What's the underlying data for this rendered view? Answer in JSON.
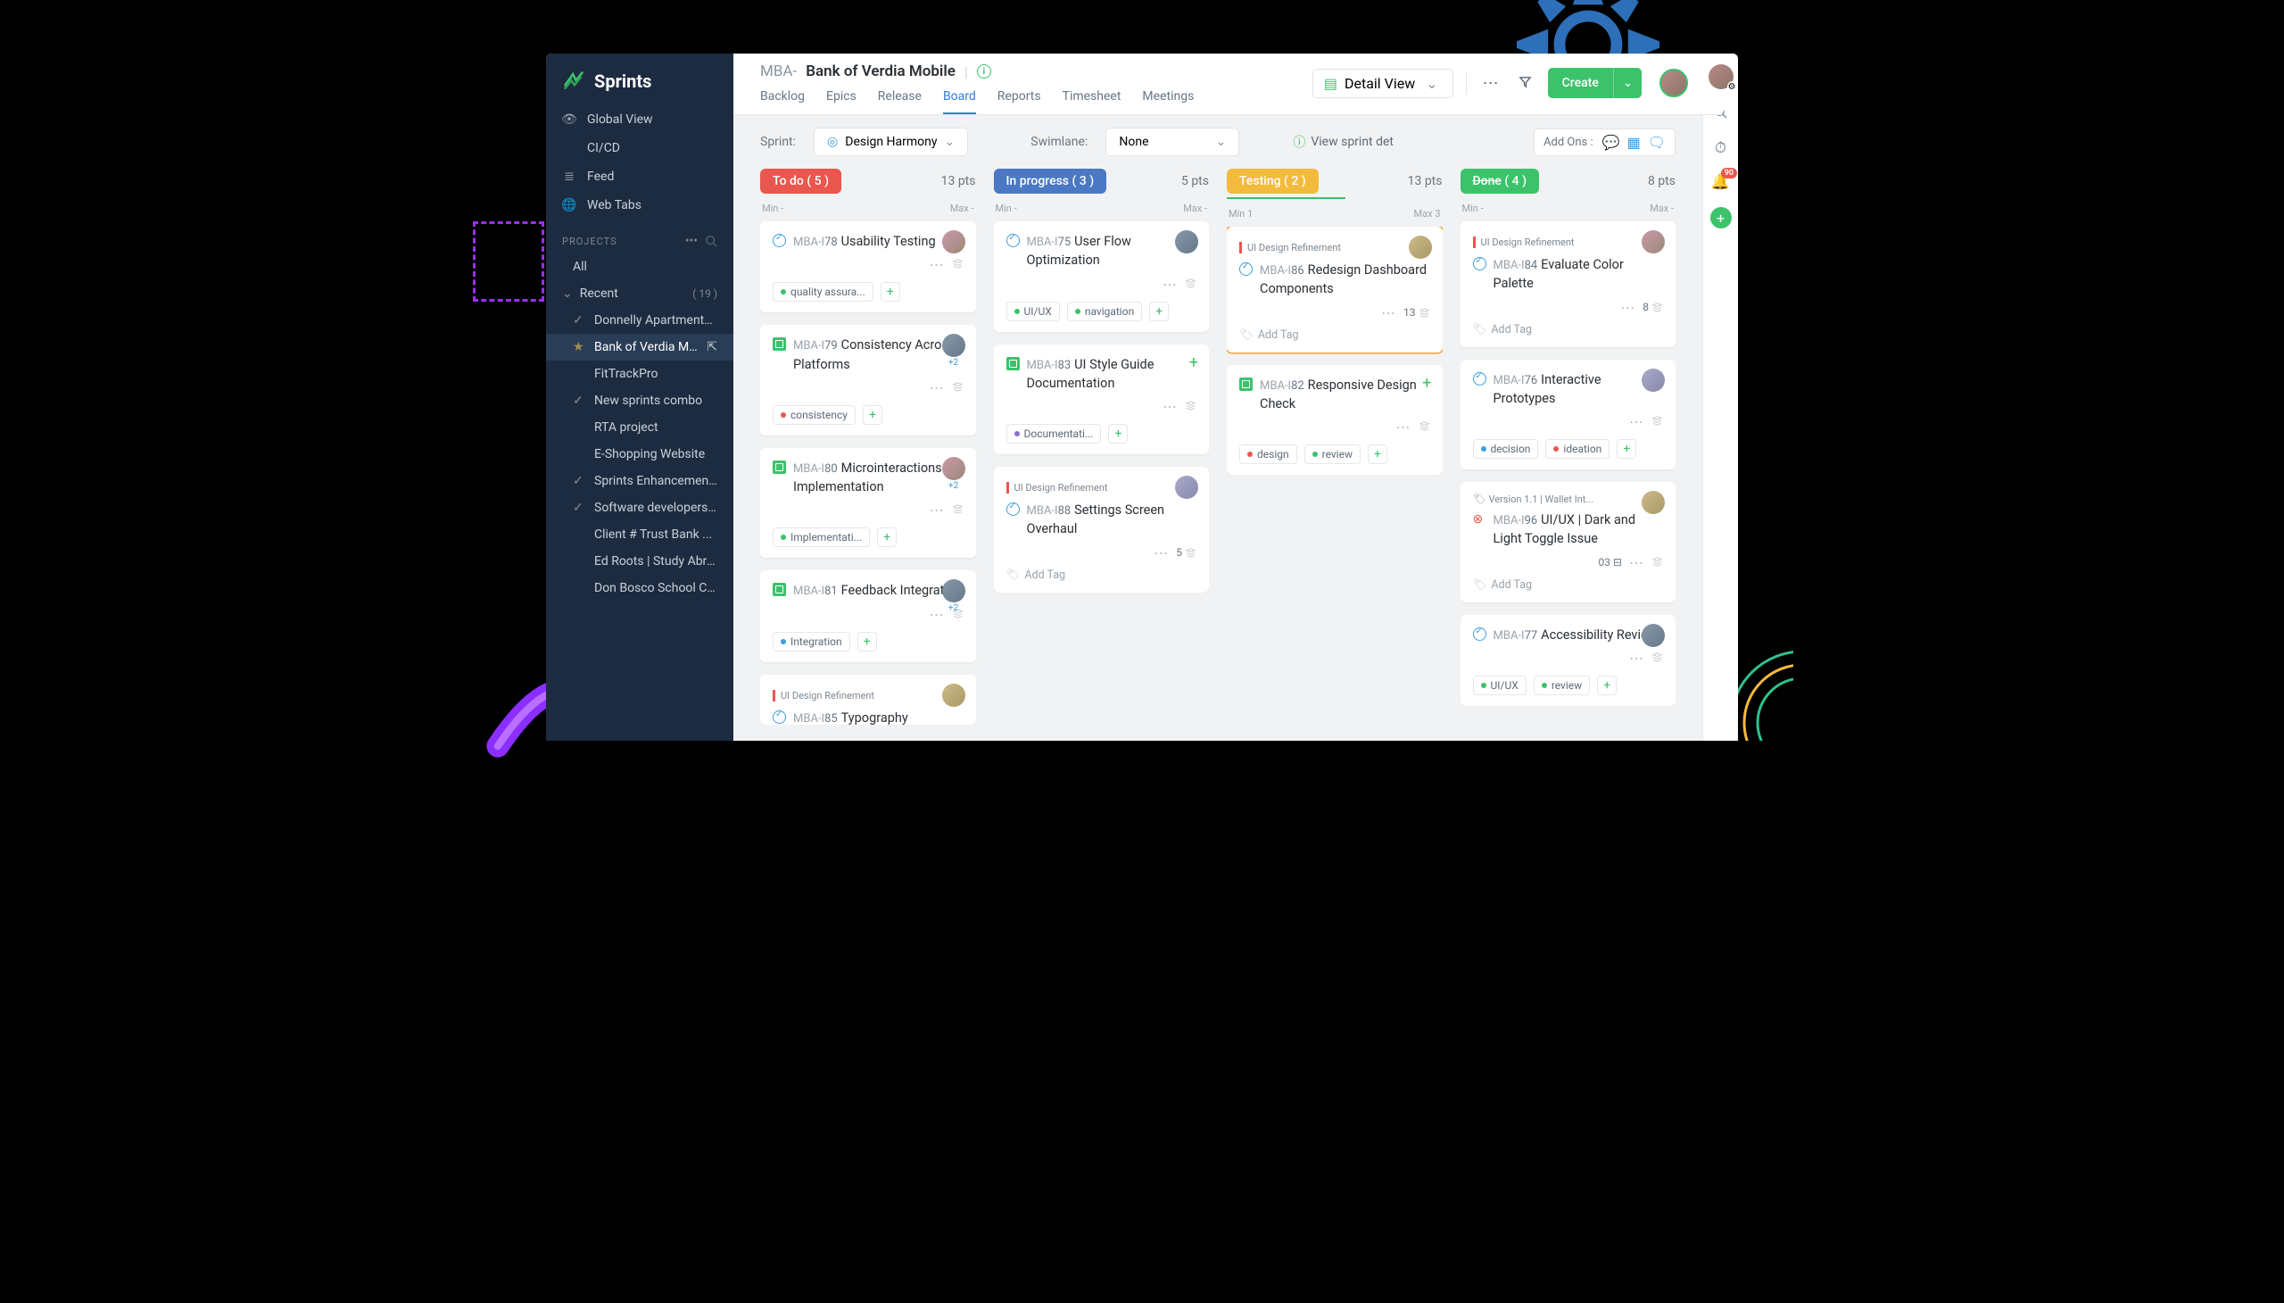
{
  "app": {
    "name": "Sprints"
  },
  "sidebar": {
    "nav": [
      {
        "label": "Global View",
        "icon": "eye"
      },
      {
        "label": "CI/CD",
        "icon": "code"
      },
      {
        "label": "Feed",
        "icon": "feed"
      },
      {
        "label": "Web Tabs",
        "icon": "globe"
      }
    ],
    "projects_label": "PROJECTS",
    "all_label": "All",
    "recent_label": "Recent",
    "recent_count": "( 19 )",
    "projects": [
      {
        "label": "Donnelly Apartments ...",
        "checked": true
      },
      {
        "label": "Bank of Verdia Mobile",
        "active": true,
        "starred": true,
        "ext": true
      },
      {
        "label": "FitTrackPro"
      },
      {
        "label": "New sprints combo",
        "checked": true
      },
      {
        "label": "RTA project"
      },
      {
        "label": "E-Shopping Website"
      },
      {
        "label": "Sprints Enhancements",
        "checked": true
      },
      {
        "label": "Software developers r...",
        "checked": true
      },
      {
        "label": "Client # Trust Bank ..."
      },
      {
        "label": "Ed Roots | Study Abro..."
      },
      {
        "label": "Don Bosco School Co..."
      }
    ]
  },
  "header": {
    "prefix": "MBA-",
    "title": "Bank of Verdia Mobile",
    "tabs": [
      "Backlog",
      "Epics",
      "Release",
      "Board",
      "Reports",
      "Timesheet",
      "Meetings"
    ],
    "active_tab": "Board",
    "view_label": "Detail View",
    "create_label": "Create"
  },
  "filters": {
    "sprint_label": "Sprint:",
    "sprint_value": "Design Harmony",
    "swimlane_label": "Swimlane:",
    "swimlane_value": "None",
    "sprint_details": "View sprint det",
    "addons_label": "Add Ons :"
  },
  "columns": [
    {
      "name": "To do",
      "count": "( 5 )",
      "pill": "pill-todo",
      "pts": "13 pts",
      "min": "Min -",
      "max": "Max -",
      "cards": [
        {
          "type": "task",
          "id": "MBA-I",
          "num": "78",
          "title": "Usability Testing",
          "avatar": "a",
          "tags": [
            {
              "text": "quality assura...",
              "dot": "green"
            }
          ],
          "tagAdd": true
        },
        {
          "type": "story",
          "id": "MBA-I",
          "num": "79",
          "title": "Consistency Across Platforms",
          "avatar": "b",
          "avMore": "+2",
          "tags": [
            {
              "text": "consistency",
              "dot": "red"
            }
          ],
          "tagAdd": true
        },
        {
          "type": "story",
          "id": "MBA-I",
          "num": "80",
          "title": "Microinteractions Implementation",
          "avatar": "a",
          "avMore": "+2",
          "tags": [
            {
              "text": "Implementati...",
              "dot": "green"
            }
          ],
          "tagAdd": true
        },
        {
          "type": "story",
          "id": "MBA-I",
          "num": "81",
          "title": "Feedback Integration",
          "avatar": "b",
          "avMore": "+2",
          "tags": [
            {
              "text": "Integration",
              "dot": "blue"
            }
          ],
          "tagAdd": true
        },
        {
          "type": "task",
          "id": "MBA-I",
          "num": "85",
          "title": "Typography",
          "epic": "UI Design Refinement",
          "avatar": "c",
          "cut": true
        }
      ]
    },
    {
      "name": "In progress",
      "count": "( 3 )",
      "pill": "pill-prog",
      "pts": "5 pts",
      "min": "Min -",
      "max": "Max -",
      "cards": [
        {
          "type": "task",
          "id": "MBA-I",
          "num": "75",
          "title": "User Flow Optimization",
          "avatar": "b",
          "tags": [
            {
              "text": "UI/UX",
              "dot": "green"
            },
            {
              "text": "navigation",
              "dot": "green"
            }
          ],
          "tagAdd": true
        },
        {
          "type": "story",
          "id": "MBA-I",
          "num": "83",
          "title": "UI Style Guide Documentation",
          "plus": true,
          "tags": [
            {
              "text": "Documentati...",
              "dot": "purple"
            }
          ],
          "tagAdd": true
        },
        {
          "type": "task",
          "id": "MBA-I",
          "num": "88",
          "title": "Settings Screen Overhaul",
          "epic": "UI Design Refinement",
          "avatar": "d",
          "est": "5",
          "addTag": true
        }
      ]
    },
    {
      "name": "Testing",
      "count": "( 2 )",
      "pill": "pill-test",
      "pts": "13 pts",
      "min": "Min 1",
      "max": "Max 3",
      "progress": true,
      "cards": [
        {
          "type": "task",
          "id": "MBA-I",
          "num": "86",
          "title": "Redesign Dashboard Components",
          "epic": "UI Design Refinement",
          "avatar": "c",
          "flag": "orange",
          "est": "13",
          "addTag": true
        },
        {
          "type": "story",
          "id": "MBA-I",
          "num": "82",
          "title": "Responsive Design Check",
          "plus": true,
          "tags": [
            {
              "text": "design",
              "dot": "red"
            },
            {
              "text": "review",
              "dot": "green"
            }
          ],
          "tagAdd": true
        }
      ]
    },
    {
      "name": "Done",
      "count": "( 4 )",
      "pill": "pill-done",
      "pts": "8 pts",
      "strike": true,
      "min": "Min -",
      "max": "Max -",
      "cards": [
        {
          "type": "task",
          "id": "MBA-I",
          "num": "84",
          "title": "Evaluate Color Palette",
          "epic": "UI Design Refinement",
          "avatar": "a",
          "est": "8",
          "addTag": true
        },
        {
          "type": "task",
          "id": "MBA-I",
          "num": "76",
          "title": "Interactive Prototypes",
          "avatar": "d",
          "tags": [
            {
              "text": "decision",
              "dot": "blue"
            },
            {
              "text": "ideation",
              "dot": "red"
            }
          ],
          "tagAdd": true
        },
        {
          "type": "bug",
          "id": "MBA-I",
          "num": "96",
          "title": "UI/UX | Dark and Light Toggle Issue",
          "version": "Version 1.1 | Wallet Int...",
          "avatar": "c",
          "ext": "03",
          "addTag": true
        },
        {
          "type": "task",
          "id": "MBA-I",
          "num": "77",
          "title": "Accessibility Review",
          "avatar": "b",
          "tags": [
            {
              "text": "UI/UX",
              "dot": "green"
            },
            {
              "text": "review",
              "dot": "green"
            }
          ],
          "tagAdd": true
        }
      ]
    }
  ],
  "rail": {
    "notif_count": "90"
  },
  "labels": {
    "add_tag": "Add Tag"
  }
}
